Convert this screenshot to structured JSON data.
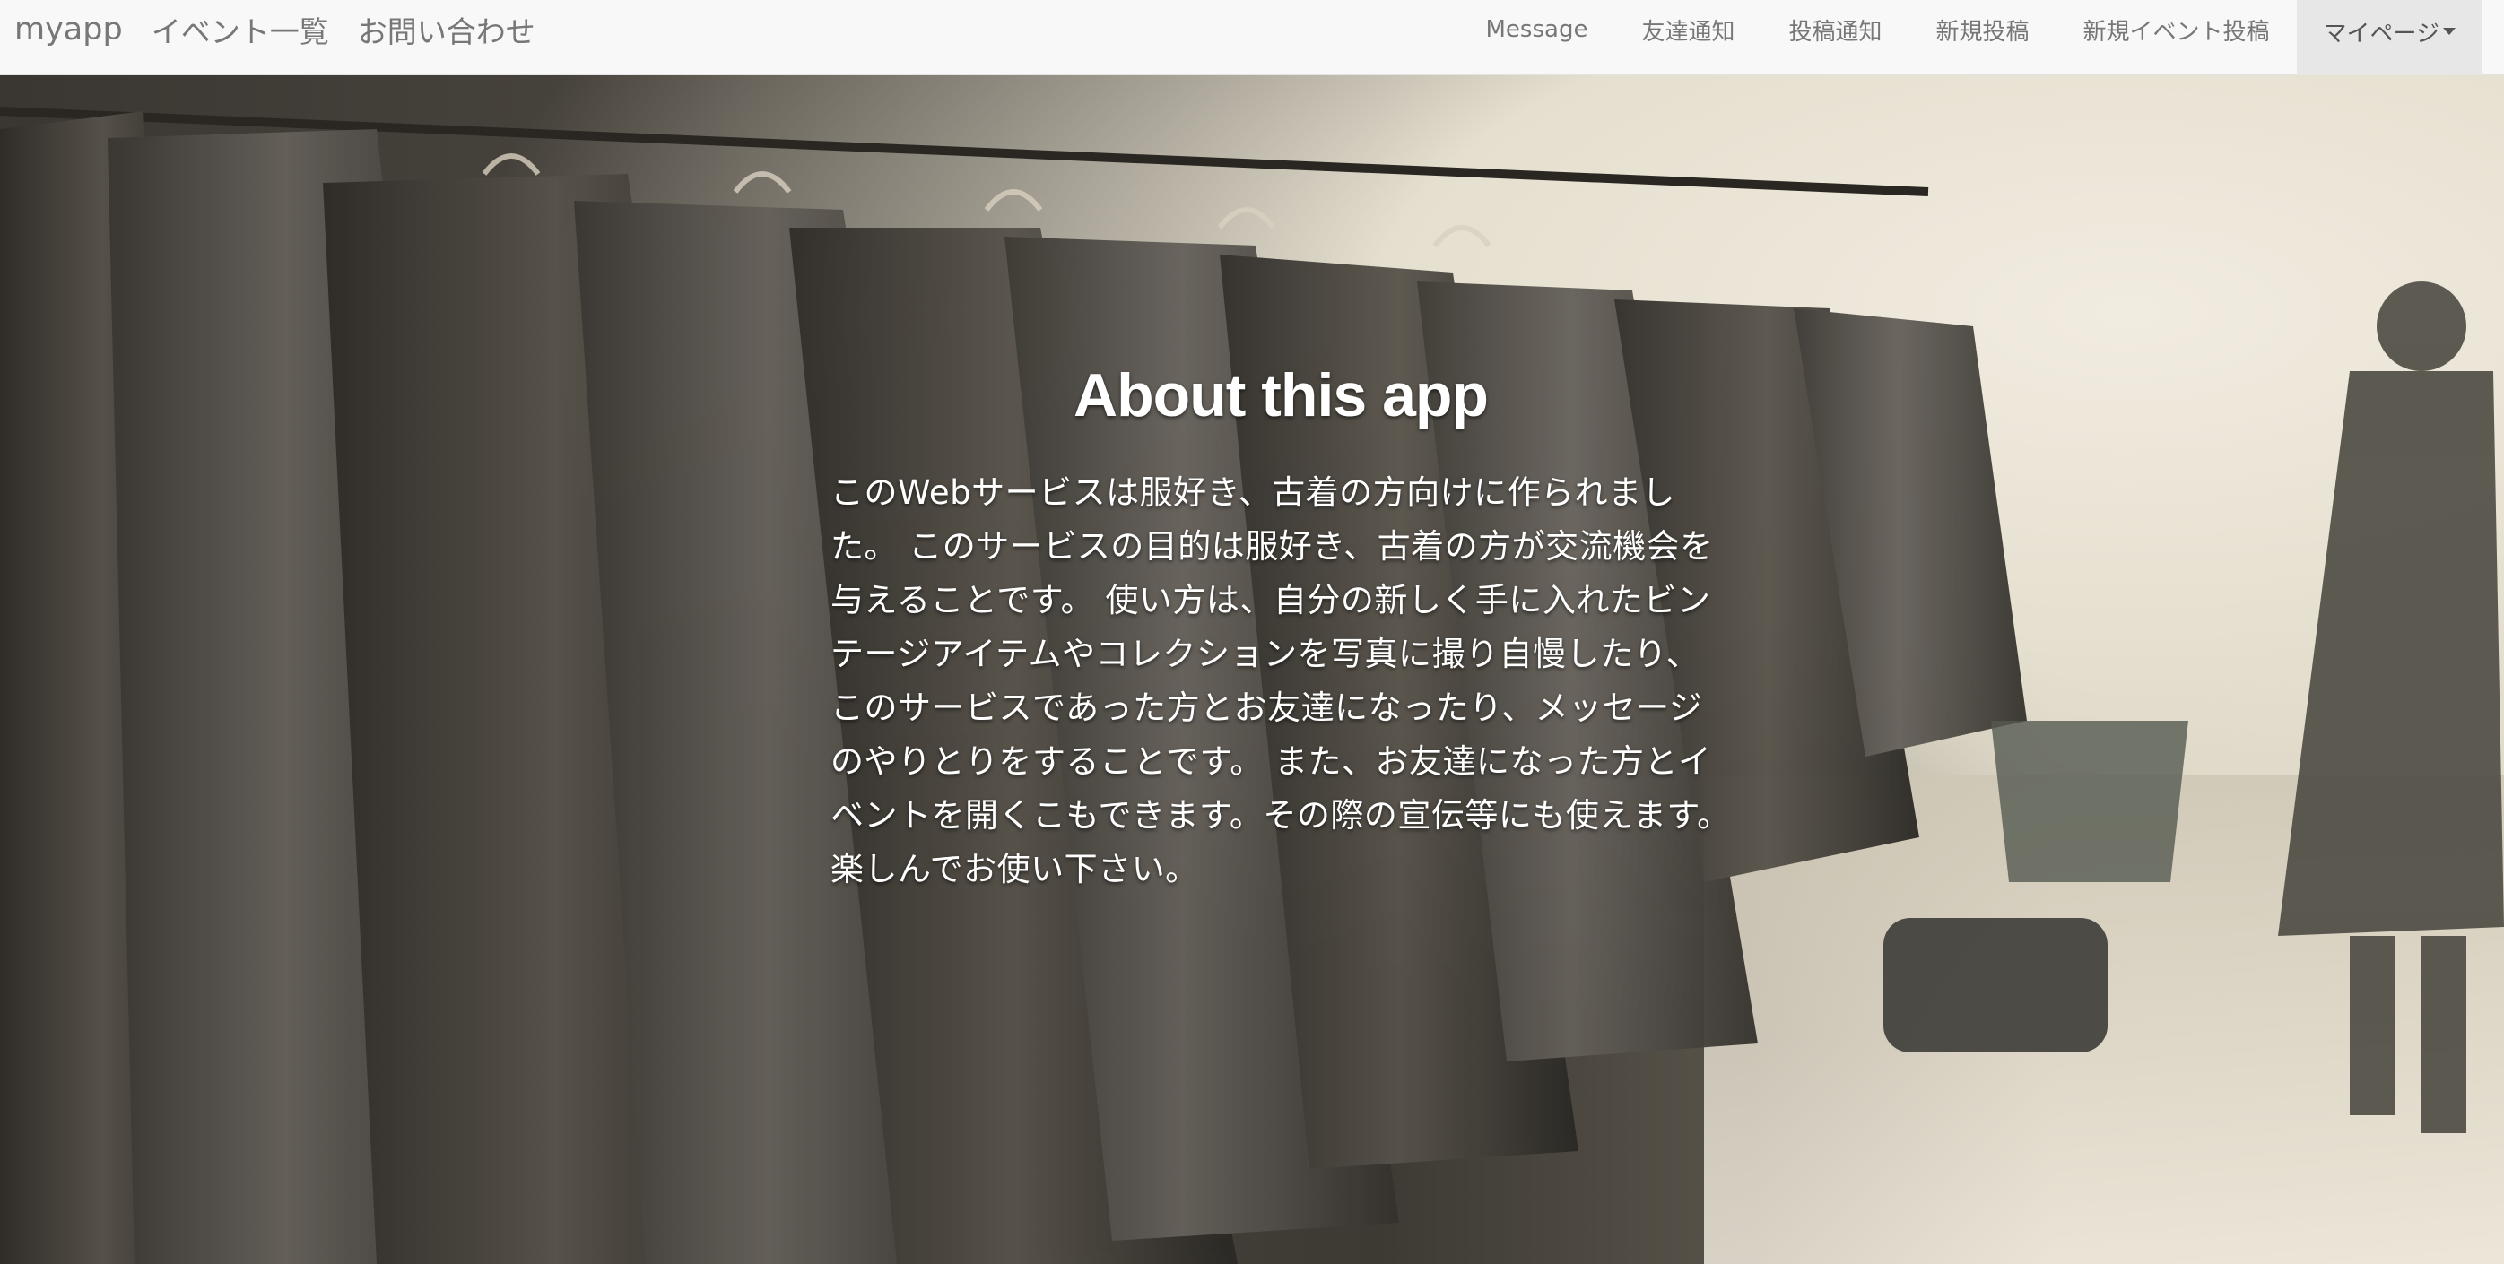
{
  "navbar": {
    "brand": "myapp",
    "left_links": [
      {
        "label": "イベント一覧"
      },
      {
        "label": "お問い合わせ"
      }
    ],
    "right_links": [
      {
        "label": "Message"
      },
      {
        "label": "友達通知"
      },
      {
        "label": "投稿通知"
      },
      {
        "label": "新規投稿"
      },
      {
        "label": "新規イベント投稿"
      }
    ],
    "mypage": {
      "label": "マイページ",
      "icon": "caret-down-icon"
    }
  },
  "hero": {
    "background": "sepia photo of coats hanging on a rack at an outdoor market",
    "title": "About this app",
    "body": "このWebサービスは服好き、古着の方向けに作られました。 このサービスの目的は服好き、古着の方が交流機会を与えることです。 使い方は、自分の新しく手に入れたビンテージアイテムやコレクションを写真に撮り自慢したり、 このサービスであった方とお友達になったり、メッセージのやりとりをすることです。 また、お友達になった方とイベントを開くこもできます。その際の宣伝等にも使えます。 楽しんでお使い下さい。"
  },
  "colors": {
    "navbar_bg": "#f8f8f8",
    "nav_text": "#777777",
    "active_bg": "#e7e7e7",
    "hero_text": "#ffffff"
  }
}
